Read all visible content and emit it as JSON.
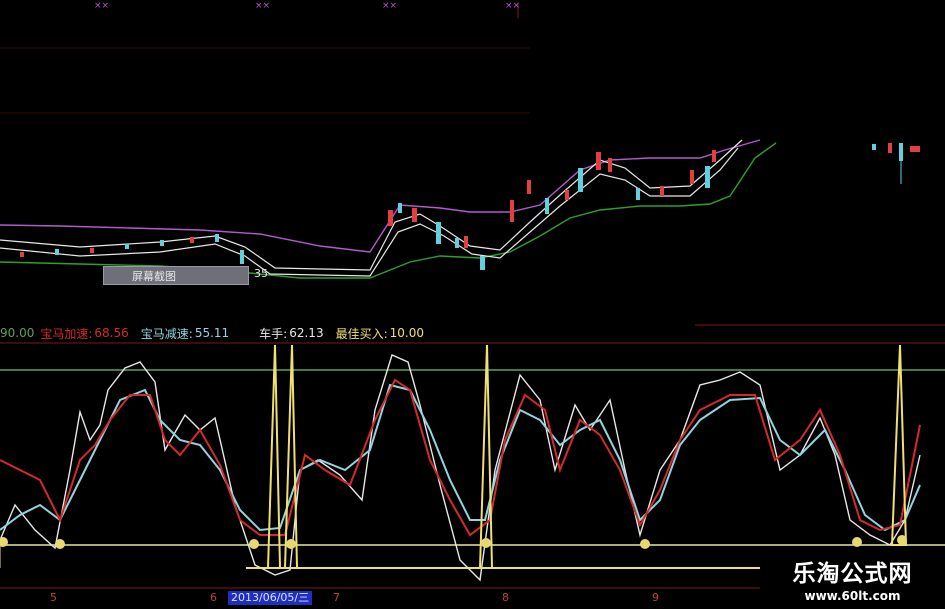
{
  "overlay": {
    "screenshot_tooltip": "屏幕截图",
    "price_label": "35"
  },
  "top_marks": [
    "××",
    "××",
    "××",
    "××"
  ],
  "indicator_legend": {
    "value_prefix": "90.00",
    "accel_label": "宝马加速:",
    "accel_value": "68.56",
    "decel_label": "宝马减速:",
    "decel_value": "55.11",
    "driver_label": "车手:",
    "driver_value": "62.13",
    "buy_label": "最佳买入:",
    "buy_value": "10.00"
  },
  "time_axis": {
    "labels": [
      "5",
      "6",
      "7",
      "8",
      "9"
    ],
    "highlighted_date": "2013/06/05/三"
  },
  "watermark": {
    "title": "乐淘公式网",
    "url": "www.60lt.com"
  },
  "colors": {
    "background": "#000000",
    "accel_line": "#d42a2a",
    "decel_line": "#8fd6e0",
    "driver_line": "#e8e8e8",
    "buy_signal": "#f0e070",
    "ref_line_upper": "#5aa25a",
    "ref_line_lower": "#e8e8a0",
    "ma_purple": "#b45ad0",
    "ma_green": "#2fa02f",
    "candle_up": "#e04040",
    "candle_down": "#60d0e0"
  }
}
